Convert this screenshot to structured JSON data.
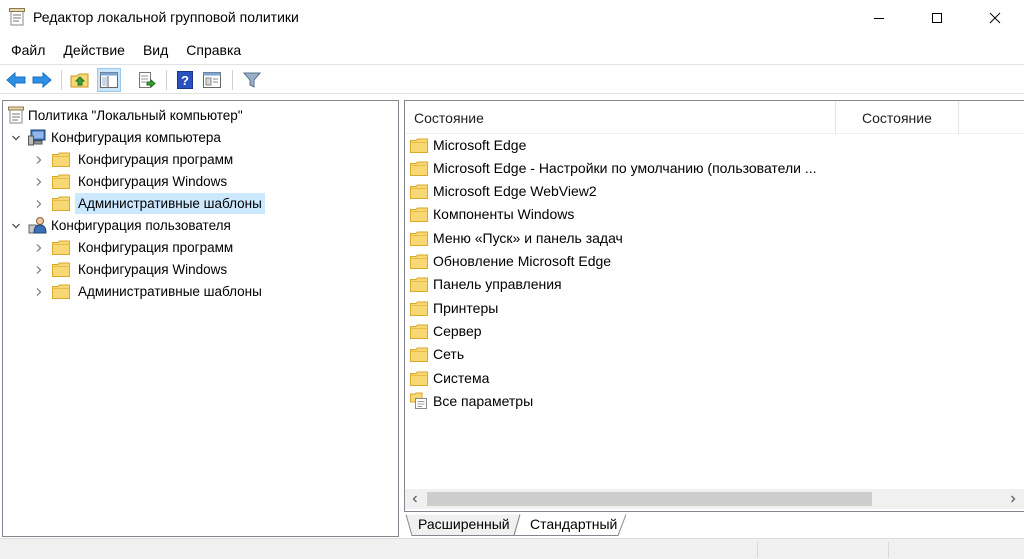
{
  "window": {
    "title": "Редактор локальной групповой политики"
  },
  "menu": [
    "Файл",
    "Действие",
    "Вид",
    "Справка"
  ],
  "toolbar": {
    "icons": [
      "back-arrow-icon",
      "forward-arrow-icon",
      "up-folder-icon",
      "show-hide-tree-icon",
      "export-list-icon",
      "help-icon",
      "properties-icon",
      "filter-icon"
    ]
  },
  "tree": {
    "root": "Политика \"Локальный компьютер\"",
    "computer": "Конфигурация компьютера",
    "computer_children": [
      "Конфигурация программ",
      "Конфигурация Windows",
      "Административные шаблоны"
    ],
    "user": "Конфигурация пользователя",
    "user_children": [
      "Конфигурация программ",
      "Конфигурация Windows",
      "Административные шаблоны"
    ]
  },
  "list": {
    "columns": [
      "Состояние",
      "Состояние"
    ],
    "items": [
      "Microsoft Edge",
      "Microsoft Edge - Настройки по умолчанию (пользователи ...",
      "Microsoft Edge WebView2",
      "Компоненты Windows",
      "Меню «Пуск» и панель задач",
      "Обновление Microsoft Edge",
      "Панель управления",
      "Принтеры",
      "Сервер",
      "Сеть",
      "Система",
      "Все параметры"
    ]
  },
  "tabs": [
    "Расширенный",
    "Стандартный"
  ],
  "colors": {
    "selection": "#cce8ff",
    "folder_fill": "#f8d775",
    "folder_edge": "#e0b034"
  }
}
